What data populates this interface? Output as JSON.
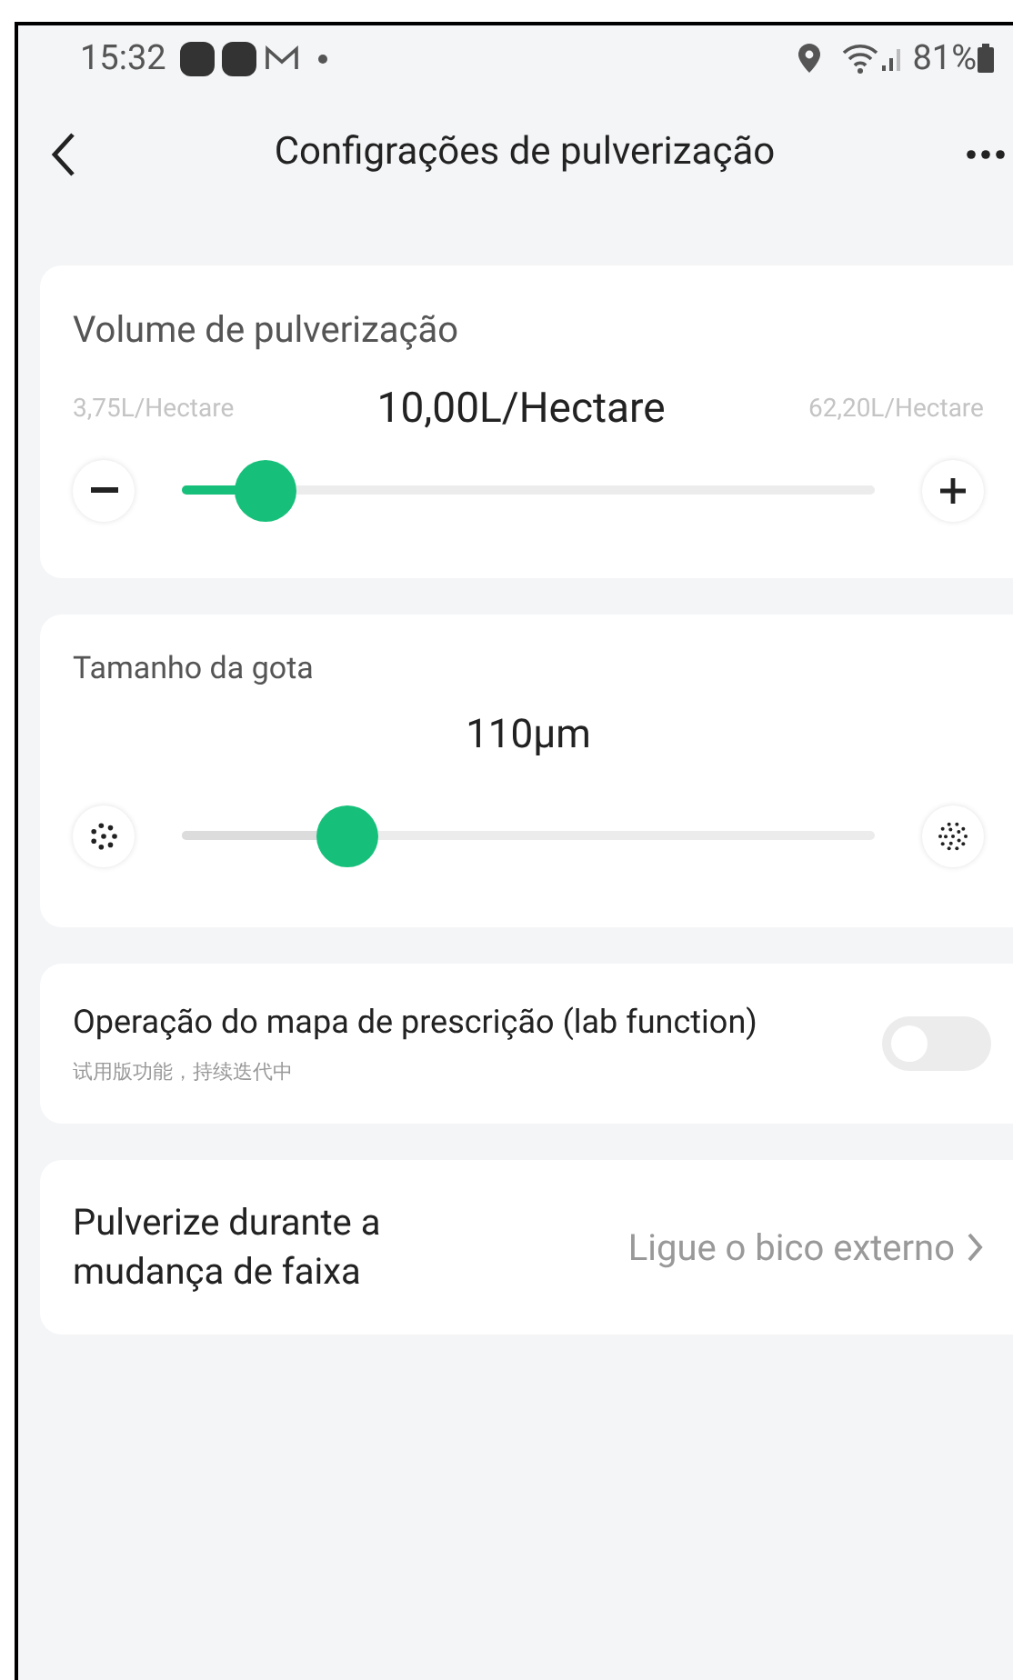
{
  "status_bar": {
    "time": "15:32",
    "battery": "81%"
  },
  "header": {
    "title": "Configrações de pulverização"
  },
  "spray_volume": {
    "title": "Volume de pulverização",
    "min": "3,75L/Hectare",
    "value": "10,00L/Hectare",
    "max": "62,20L/Hectare",
    "level": 0.12
  },
  "droplet_size": {
    "title": "Tamanho da gota",
    "value": "110µm",
    "level": 0.24
  },
  "prescription_map": {
    "title": "Operação do mapa de prescrição (lab function)",
    "subtitle": "试用版功能，持续迭代中",
    "on": false
  },
  "lane_change": {
    "title": "Pulverize durante a mudança de faixa",
    "value": "Ligue o bico externo"
  }
}
